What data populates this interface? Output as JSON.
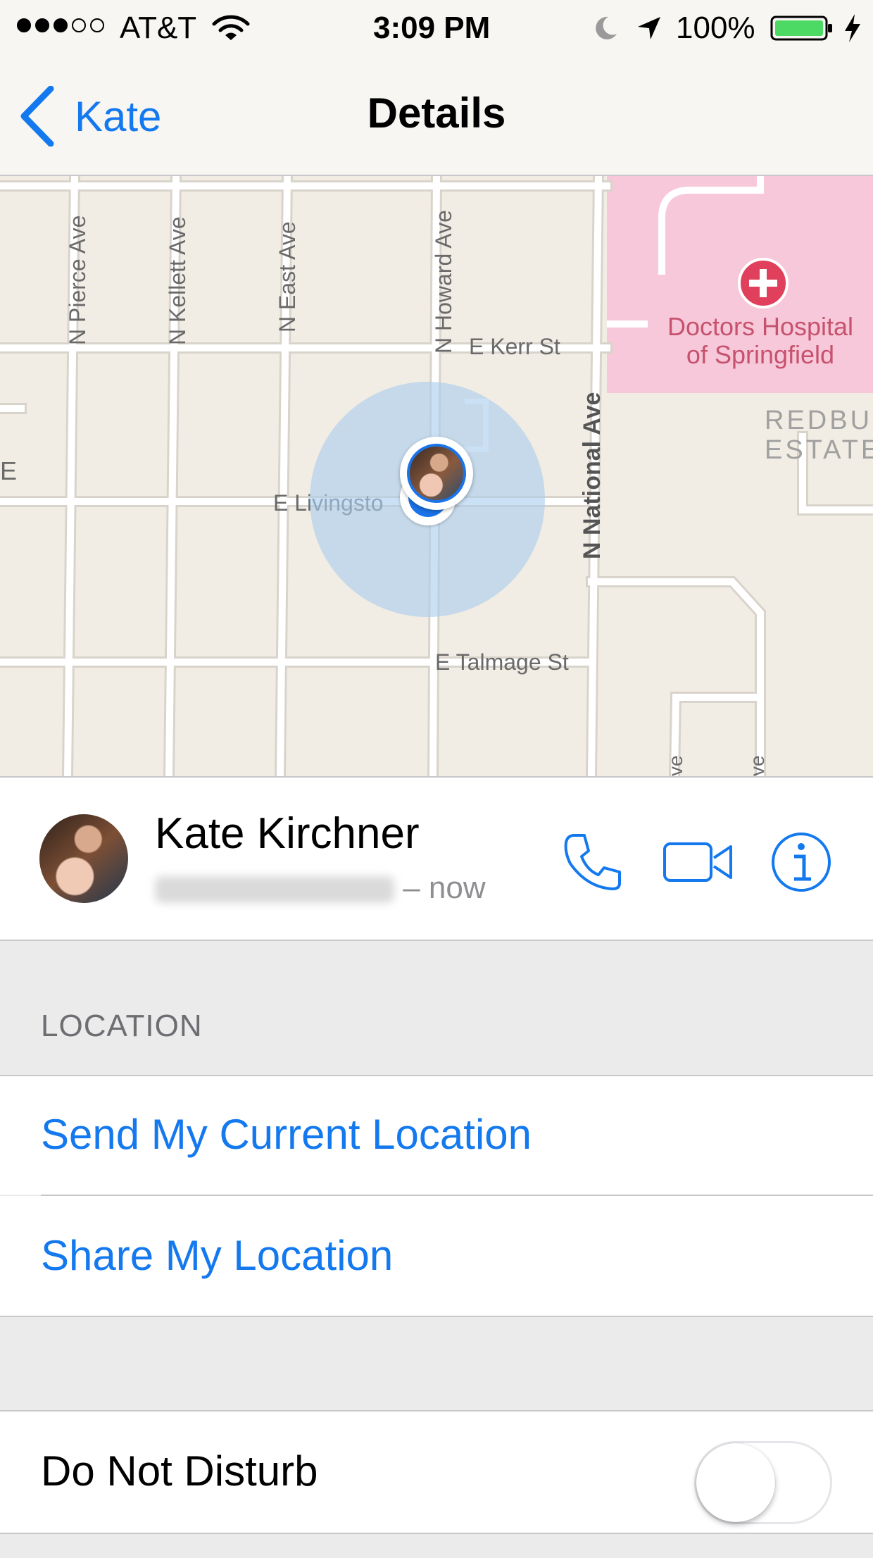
{
  "status_bar": {
    "carrier": "AT&T",
    "signal_bars_filled": 3,
    "signal_bars_total": 5,
    "time": "3:09 PM",
    "battery_percent": "100%",
    "icons": [
      "wifi-icon",
      "moon-icon",
      "location-arrow-icon",
      "battery-icon",
      "charging-bolt-icon"
    ]
  },
  "nav": {
    "back_label": "Kate",
    "title": "Details"
  },
  "map": {
    "streets": {
      "n_pierce": "N Pierce Ave",
      "n_kellett": "N Kellett Ave",
      "n_east": "N East Ave",
      "n_howard": "N Howard Ave",
      "e_kerr": "E Kerr St",
      "n_national": "N National Ave",
      "e_livingston": "E Livingsto",
      "e_talmage": "E Talmage St",
      "edge_e": "E",
      "partial_1": "ve",
      "partial_2": "ve"
    },
    "hospital_line1": "Doctors Hospital",
    "hospital_line2": "of Springfield",
    "estate_line1": "REDBU",
    "estate_line2": "ESTATE",
    "colors": {
      "land": "#f2ede4",
      "hospital_area": "#f7c8d9",
      "accuracy_circle": "#aacdee",
      "pin": "#1a73e8"
    }
  },
  "contact": {
    "name": "Kate Kirchner",
    "time_suffix": "– now"
  },
  "location_section": {
    "header": "LOCATION",
    "send_current": "Send My Current Location",
    "share": "Share My Location"
  },
  "settings": {
    "do_not_disturb_label": "Do Not Disturb",
    "do_not_disturb_on": false
  },
  "colors": {
    "accent": "#1479ee",
    "group_bg": "#ebebeb",
    "separator": "#c8c7cc"
  }
}
